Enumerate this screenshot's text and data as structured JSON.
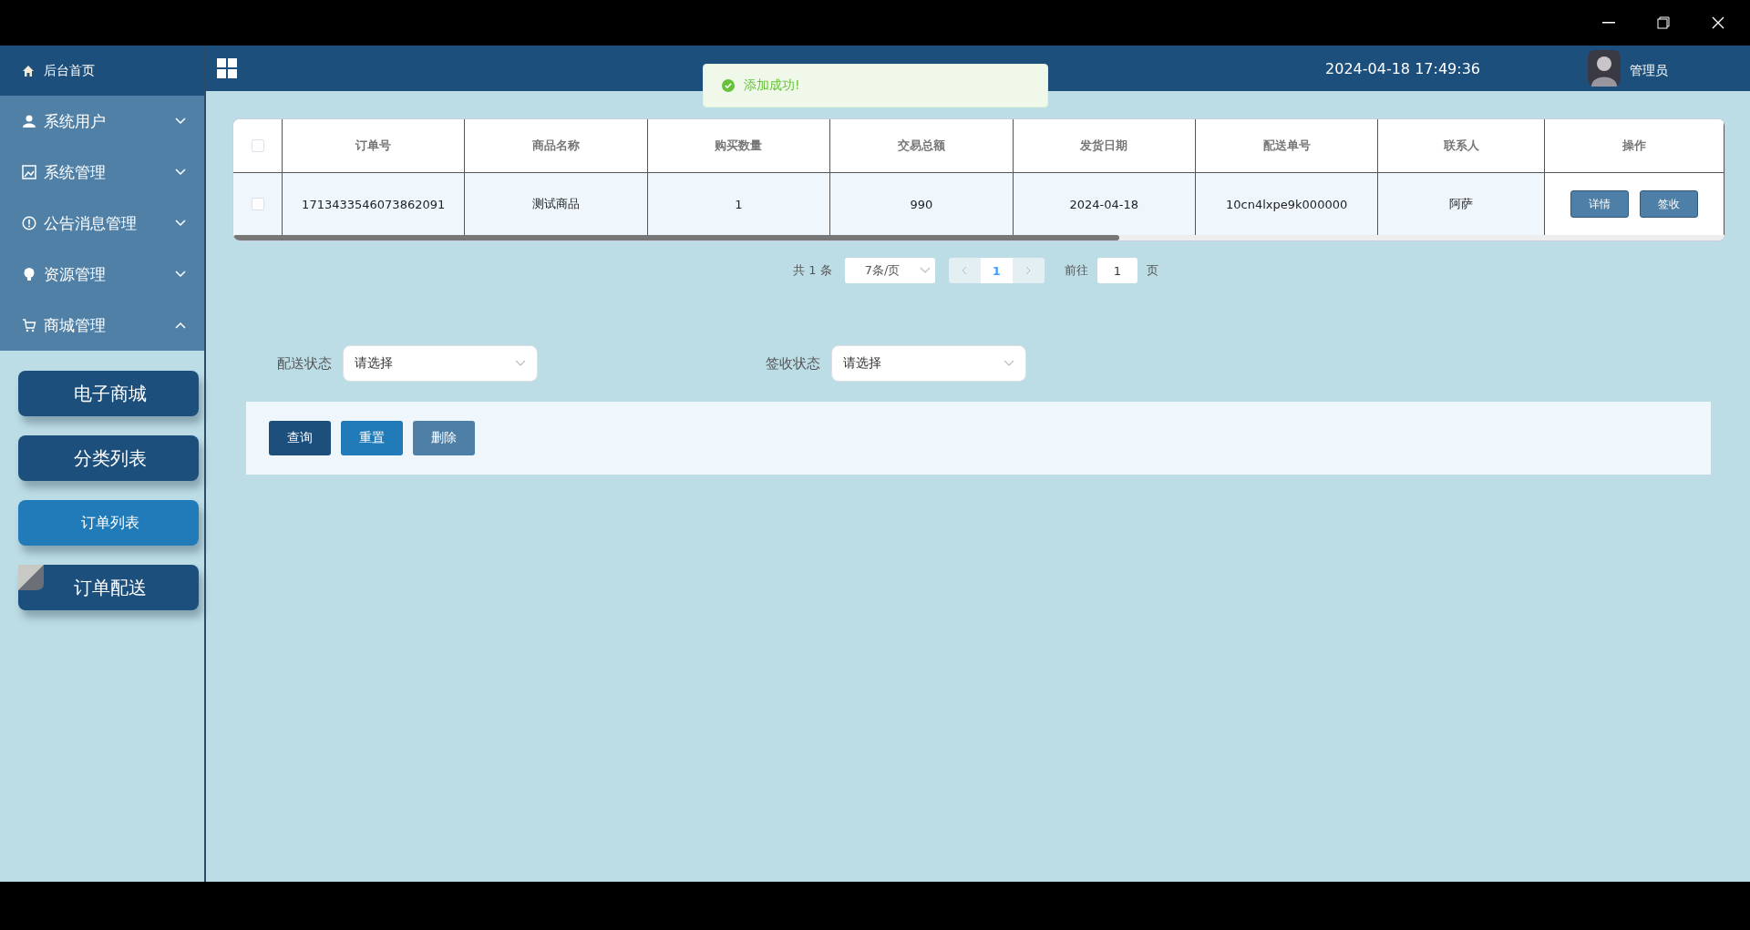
{
  "header": {
    "datetime": "2024-04-18 17:49:36",
    "user": "管理员"
  },
  "toast": {
    "text": "添加成功!"
  },
  "sidebar": {
    "home": {
      "label": "后台首页"
    },
    "items": [
      {
        "label": "系统用户",
        "expanded": false
      },
      {
        "label": "系统管理",
        "expanded": false
      },
      {
        "label": "公告消息管理",
        "expanded": false
      },
      {
        "label": "资源管理",
        "expanded": false
      },
      {
        "label": "商城管理",
        "expanded": true
      }
    ],
    "sub_items": [
      {
        "label": "电子商城",
        "selected": false
      },
      {
        "label": "分类列表",
        "selected": false
      },
      {
        "label": "订单列表",
        "selected": true
      },
      {
        "label": "订单配送",
        "selected": false
      }
    ]
  },
  "table": {
    "select_all": {
      "checked": false
    },
    "columns": [
      "订单号",
      "商品名称",
      "购买数量",
      "交易总额",
      "发货日期",
      "配送单号",
      "联系人",
      "操作"
    ],
    "rows": [
      {
        "checked": false,
        "cells": [
          "1713433546073862091",
          "测试商品",
          "1",
          "990",
          "2024-04-18",
          "10cn4lxpe9k000000",
          "阿萨"
        ],
        "actions": [
          "详情",
          "签收"
        ]
      }
    ]
  },
  "pagination": {
    "total": "共 1 条",
    "page_size": "7条/页",
    "current": "1",
    "goto_label": "前往",
    "goto_value": "1",
    "goto_suffix": "页"
  },
  "filters": [
    {
      "label": "配送状态",
      "placeholder": "请选择"
    },
    {
      "label": "签收状态",
      "placeholder": "请选择"
    }
  ],
  "buttons": [
    {
      "label": "查询",
      "kind": "query"
    },
    {
      "label": "重置",
      "kind": "reset"
    },
    {
      "label": "删除",
      "kind": "delete"
    }
  ]
}
